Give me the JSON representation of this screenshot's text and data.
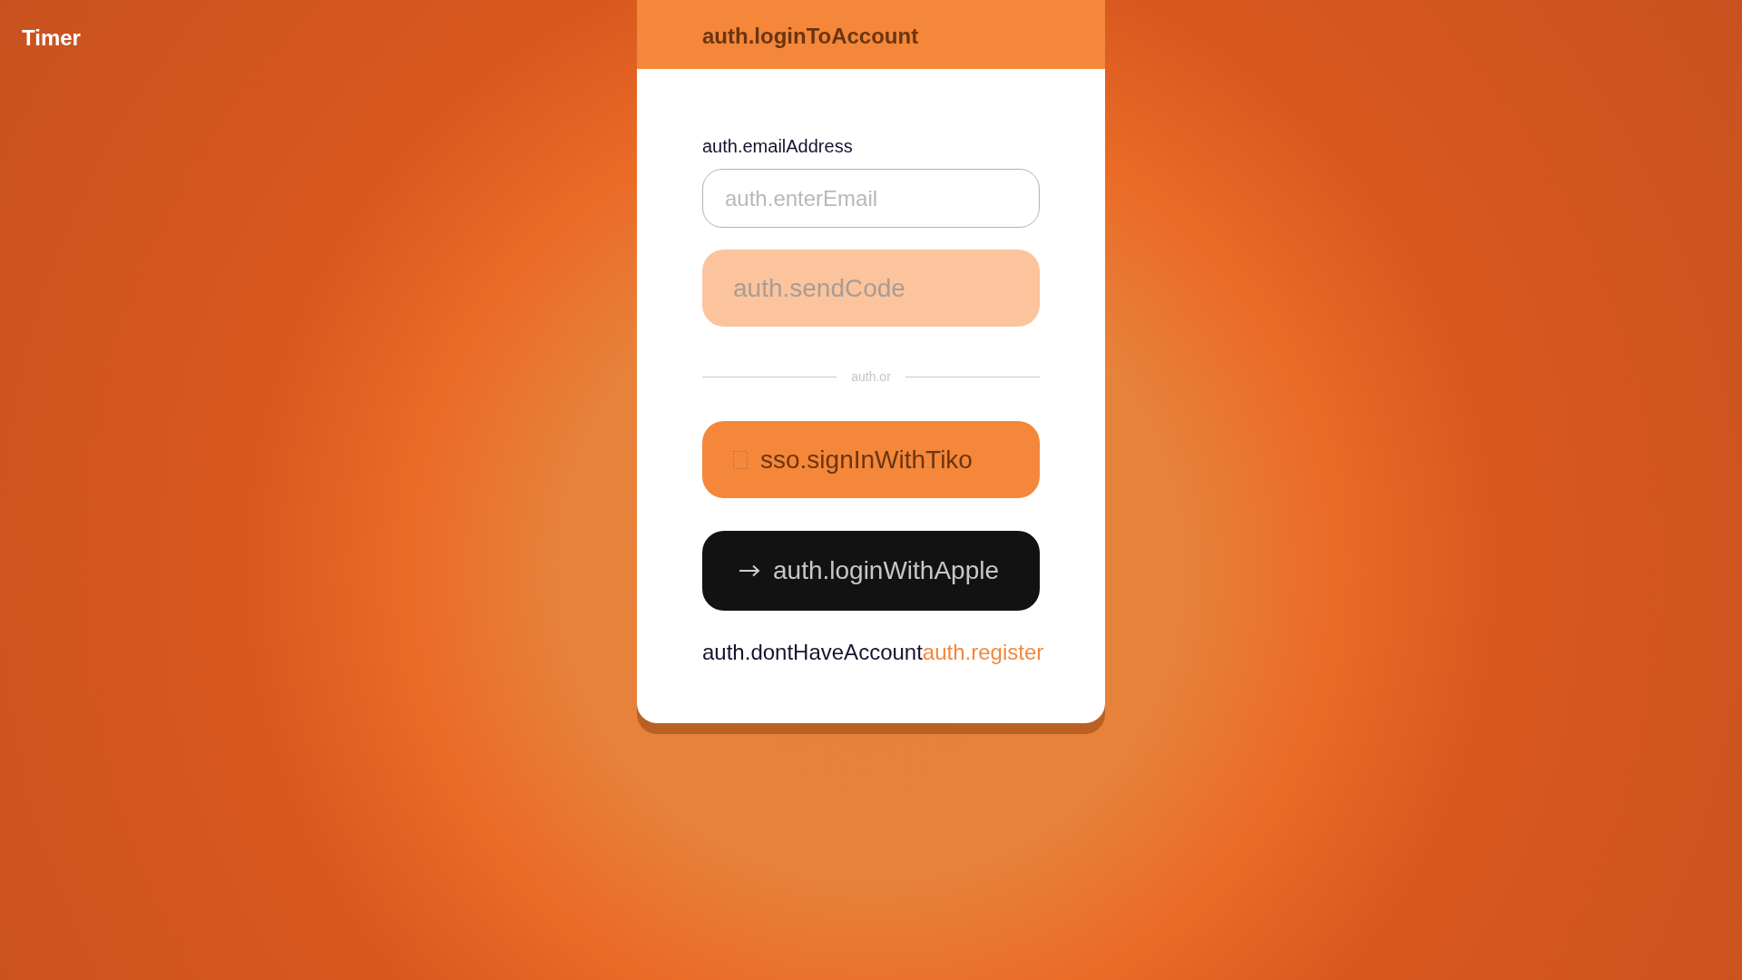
{
  "app_title": "Timer",
  "card": {
    "title": "auth.loginToAccount",
    "email": {
      "label": "auth.emailAddress",
      "placeholder": "auth.enterEmail"
    },
    "send_code": {
      "label": "auth.sendCode",
      "disabled": true
    },
    "divider": "auth.or",
    "buttons": [
      {
        "kind": "sso",
        "label": "sso.signInWithTiko"
      },
      {
        "kind": "apple",
        "label": "auth.loginWithApple"
      }
    ],
    "footer": {
      "text": "auth.dontHaveAccount",
      "link": "auth.register"
    }
  }
}
